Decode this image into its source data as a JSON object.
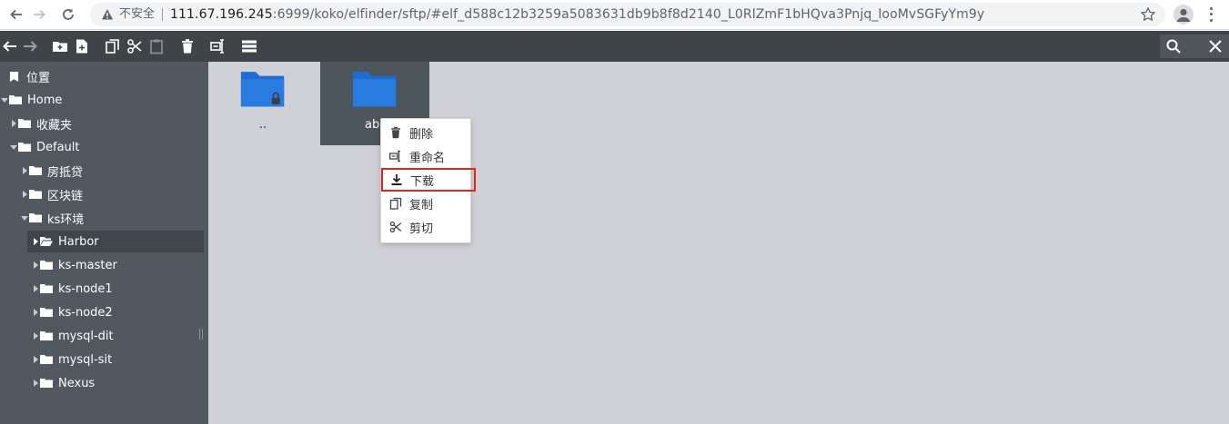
{
  "browser": {
    "insecure_label": "不安全",
    "url_host": "111.67.196.245",
    "url_rest": ":6999/koko/elfinder/sftp/#elf_d588c12b3259a5083631db9b8f8d2140_L0RlZmF1bHQva3Pnjq_looMvSGFyYm9y"
  },
  "toolbar": {
    "icons": [
      "back-icon",
      "forward-icon",
      "new-folder-icon",
      "new-file-icon",
      "copy-icon",
      "cut-icon",
      "paste-icon",
      "delete-icon",
      "rename-icon",
      "view-list-icon"
    ]
  },
  "tree": {
    "places_label": "位置",
    "home_label": "Home",
    "favorites_label": "收藏夹",
    "default_label": "Default",
    "items": [
      {
        "label": "房抵贷"
      },
      {
        "label": "区块链"
      },
      {
        "label": "ks环境"
      },
      {
        "label": "Harbor"
      },
      {
        "label": "ks-master"
      },
      {
        "label": "ks-node1"
      },
      {
        "label": "ks-node2"
      },
      {
        "label": "mysql-dit"
      },
      {
        "label": "mysql-sit"
      },
      {
        "label": "Nexus"
      }
    ]
  },
  "workzone": {
    "parent_label": "..",
    "selected_label": "abc"
  },
  "context_menu": {
    "items": [
      {
        "label": "删除",
        "icon": "trash-icon"
      },
      {
        "label": "重命名",
        "icon": "rename-icon"
      },
      {
        "label": "下载",
        "icon": "download-icon"
      },
      {
        "label": "复制",
        "icon": "copy-icon"
      },
      {
        "label": "剪切",
        "icon": "scissors-icon"
      }
    ],
    "highlight_color": "#e0261b"
  },
  "colors": {
    "toolbar_bg": "#3f4449",
    "navbar_bg": "#515860",
    "workzone_bg": "#d0d1d6",
    "folder_blue": "#1d6bd3"
  }
}
